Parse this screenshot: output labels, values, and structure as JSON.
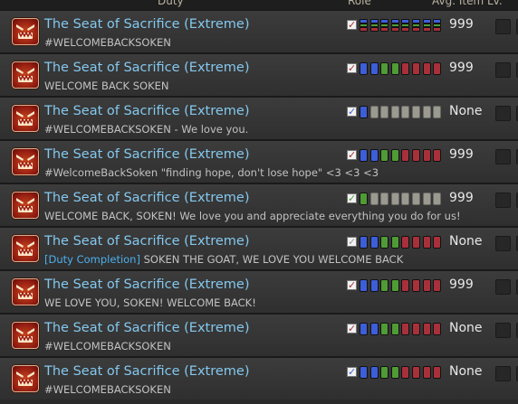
{
  "columns": {
    "duty": "Duty",
    "role": "Role",
    "avg_item_level": "Avg. Item Lv."
  },
  "colors": {
    "tank": "#3d5ed9",
    "healer": "#4f9b35",
    "dps": "#a8303a",
    "open": "#9a9a90"
  },
  "rows": [
    {
      "title": "The Seat of Sacrifice (Extreme)",
      "tag": "",
      "comment": "#WELCOMEBACKSOKEN",
      "check_role": "dps",
      "ilvl": "999",
      "slots": [
        [
          "tank",
          "healer",
          "dps"
        ],
        [
          "tank",
          "healer",
          "dps"
        ],
        [
          "tank",
          "healer",
          "dps"
        ],
        [
          "tank",
          "healer",
          "dps"
        ],
        [
          "tank",
          "healer",
          "dps"
        ],
        [
          "tank",
          "healer",
          "dps"
        ],
        [
          "tank",
          "healer",
          "dps"
        ],
        [
          "tank",
          "healer",
          "dps"
        ]
      ]
    },
    {
      "title": "The Seat of Sacrifice (Extreme)",
      "tag": "",
      "comment": "WELCOME BACK SOKEN",
      "check_role": "dps",
      "ilvl": "999",
      "slots": [
        "tank",
        "tank",
        "healer",
        "healer",
        "dps",
        "dps",
        "dps",
        "dps"
      ]
    },
    {
      "title": "The Seat of Sacrifice (Extreme)",
      "tag": "",
      "comment": "#WELCOMEBACKSOKEN -  We love you.",
      "check_role": "tank",
      "ilvl": "None",
      "slots": [
        "tank",
        "open",
        "open",
        "open",
        "open",
        "open",
        "open",
        "open"
      ]
    },
    {
      "title": "The Seat of Sacrifice (Extreme)",
      "tag": "",
      "comment": "#WelcomeBackSoken \"finding hope, don't lose hope\" <3 <3 <3",
      "check_role": "dps",
      "ilvl": "999",
      "slots": [
        "tank",
        "tank",
        "healer",
        "healer",
        "dps",
        "dps",
        "dps",
        "dps"
      ]
    },
    {
      "title": "The Seat of Sacrifice (Extreme)",
      "tag": "",
      "comment": "WELCOME BACK, SOKEN! We love you and appreciate everything you do for us!",
      "check_role": "healer",
      "ilvl": "999",
      "slots": [
        "healer",
        "open",
        "open",
        "open",
        "open",
        "open",
        "open",
        "open"
      ]
    },
    {
      "title": "The Seat of Sacrifice (Extreme)",
      "tag": "[Duty Completion]",
      "comment": "SOKEN THE GOAT, WE LOVE YOU WELCOME BACK",
      "check_role": "open",
      "ilvl": "None",
      "slots": [
        "tank",
        "tank",
        "healer",
        "healer",
        "dps",
        "dps",
        "dps",
        "dps"
      ]
    },
    {
      "title": "The Seat of Sacrifice (Extreme)",
      "tag": "",
      "comment": "WE LOVE YOU, SOKEN! WELCOME BACK!",
      "check_role": "dps",
      "ilvl": "999",
      "slots": [
        "tank",
        "tank",
        "healer",
        "healer",
        "dps",
        "dps",
        "dps",
        "dps"
      ]
    },
    {
      "title": "The Seat of Sacrifice (Extreme)",
      "tag": "",
      "comment": "#WELCOMEBACKSOKEN",
      "check_role": "dps",
      "ilvl": "None",
      "slots": [
        "tank",
        "tank",
        "healer",
        "healer",
        "dps",
        "dps",
        "dps",
        "dps"
      ]
    },
    {
      "title": "The Seat of Sacrifice (Extreme)",
      "tag": "",
      "comment": "#WELCOMEBACKSOKEN",
      "check_role": "tank",
      "ilvl": "None",
      "slots": [
        "tank",
        "tank",
        "healer",
        "healer",
        "dps",
        "dps",
        "dps",
        "dps"
      ]
    }
  ]
}
